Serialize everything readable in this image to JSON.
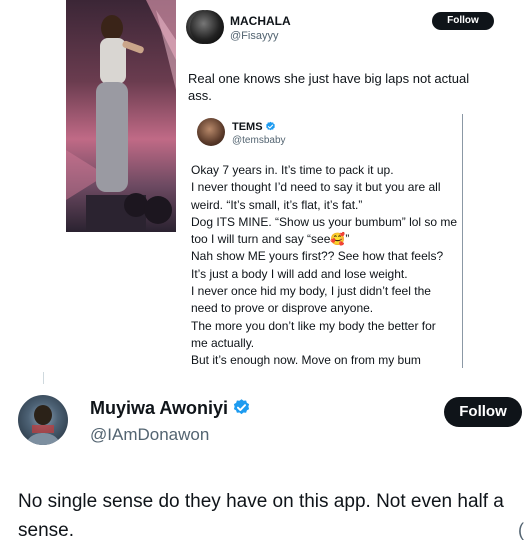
{
  "quoted_tweet": {
    "author_name": "MACHALA",
    "author_handle": "@Fisayyy",
    "follow_label": "Follow",
    "text": "Real one knows she just have big laps not actual ass."
  },
  "nested_quote": {
    "author_name": "TEMS",
    "author_handle": "@temsbaby",
    "lines": [
      "Okay 7 years in. It’s time to pack it up.",
      "I never thought I’d need to say it but you are all",
      "weird. “It’s small, it’s flat, it’s fat.”",
      "Dog ITS MINE. “Show us your bumbum” lol so me",
      "too I will turn and say “see🥰”",
      "Nah show ME yours first?? See how that feels?",
      "It’s just a body I will add and lose weight.",
      "I never once hid my body, I just didn’t feel the",
      "need to prove or disprove anyone.",
      "The more you don’t like my body the better for",
      "me actually.",
      "But it’s enough now. Move on from my bum"
    ]
  },
  "tweet": {
    "author_name": "Muyiwa Awoniyi",
    "author_handle": "@IAmDonawon",
    "follow_label": "Follow",
    "text": "No single sense do they have on this app. Not even half a sense."
  },
  "colors": {
    "text_primary": "#0f1419",
    "text_secondary": "#536471",
    "verified_blue": "#1d9bf0",
    "button_bg": "#0f1419"
  },
  "icons": {
    "verified": "verified-badge-icon"
  }
}
